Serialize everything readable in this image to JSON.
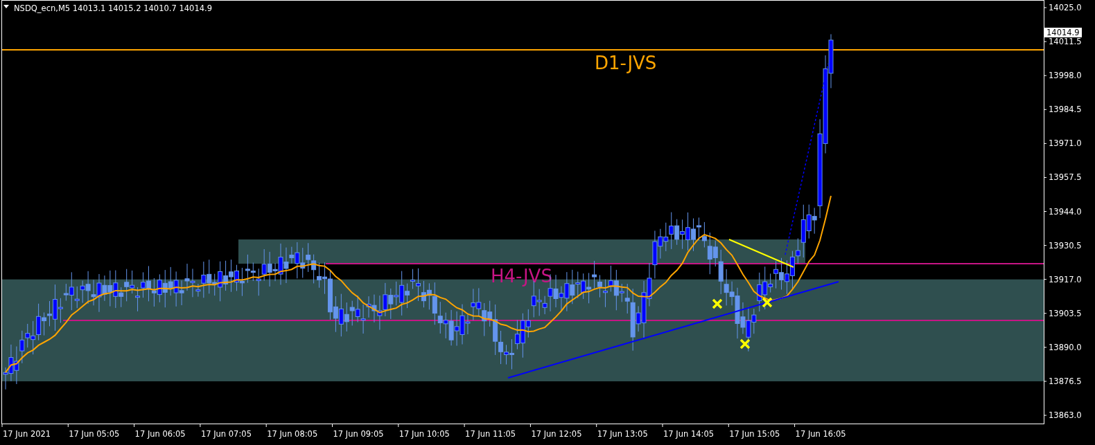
{
  "header": {
    "symbol": "NSDQ_ecn,M5",
    "ohlc": [
      "14013.1",
      "14015.2",
      "14010.7",
      "14014.9"
    ]
  },
  "levels": [
    {
      "label": "D1-JVS",
      "color": "#ffa500"
    },
    {
      "label": "H4-JVS",
      "color": "#c71585"
    }
  ],
  "price_axis": {
    "labels": [
      "14025.0",
      "14011.5",
      "13998.0",
      "13984.5",
      "13971.0",
      "13957.5",
      "13944.0",
      "13930.5",
      "13917.0",
      "13903.5",
      "13890.0",
      "13876.5",
      "13863.0"
    ],
    "current_price": "14014.9"
  },
  "time_axis": {
    "labels": [
      "17 Jun 2021",
      "17 Jun 05:05",
      "17 Jun 06:05",
      "17 Jun 07:05",
      "17 Jun 08:05",
      "17 Jun 09:05",
      "17 Jun 10:05",
      "17 Jun 11:05",
      "17 Jun 12:05",
      "17 Jun 13:05",
      "17 Jun 14:05",
      "17 Jun 15:05",
      "17 Jun 16:05"
    ]
  }
}
